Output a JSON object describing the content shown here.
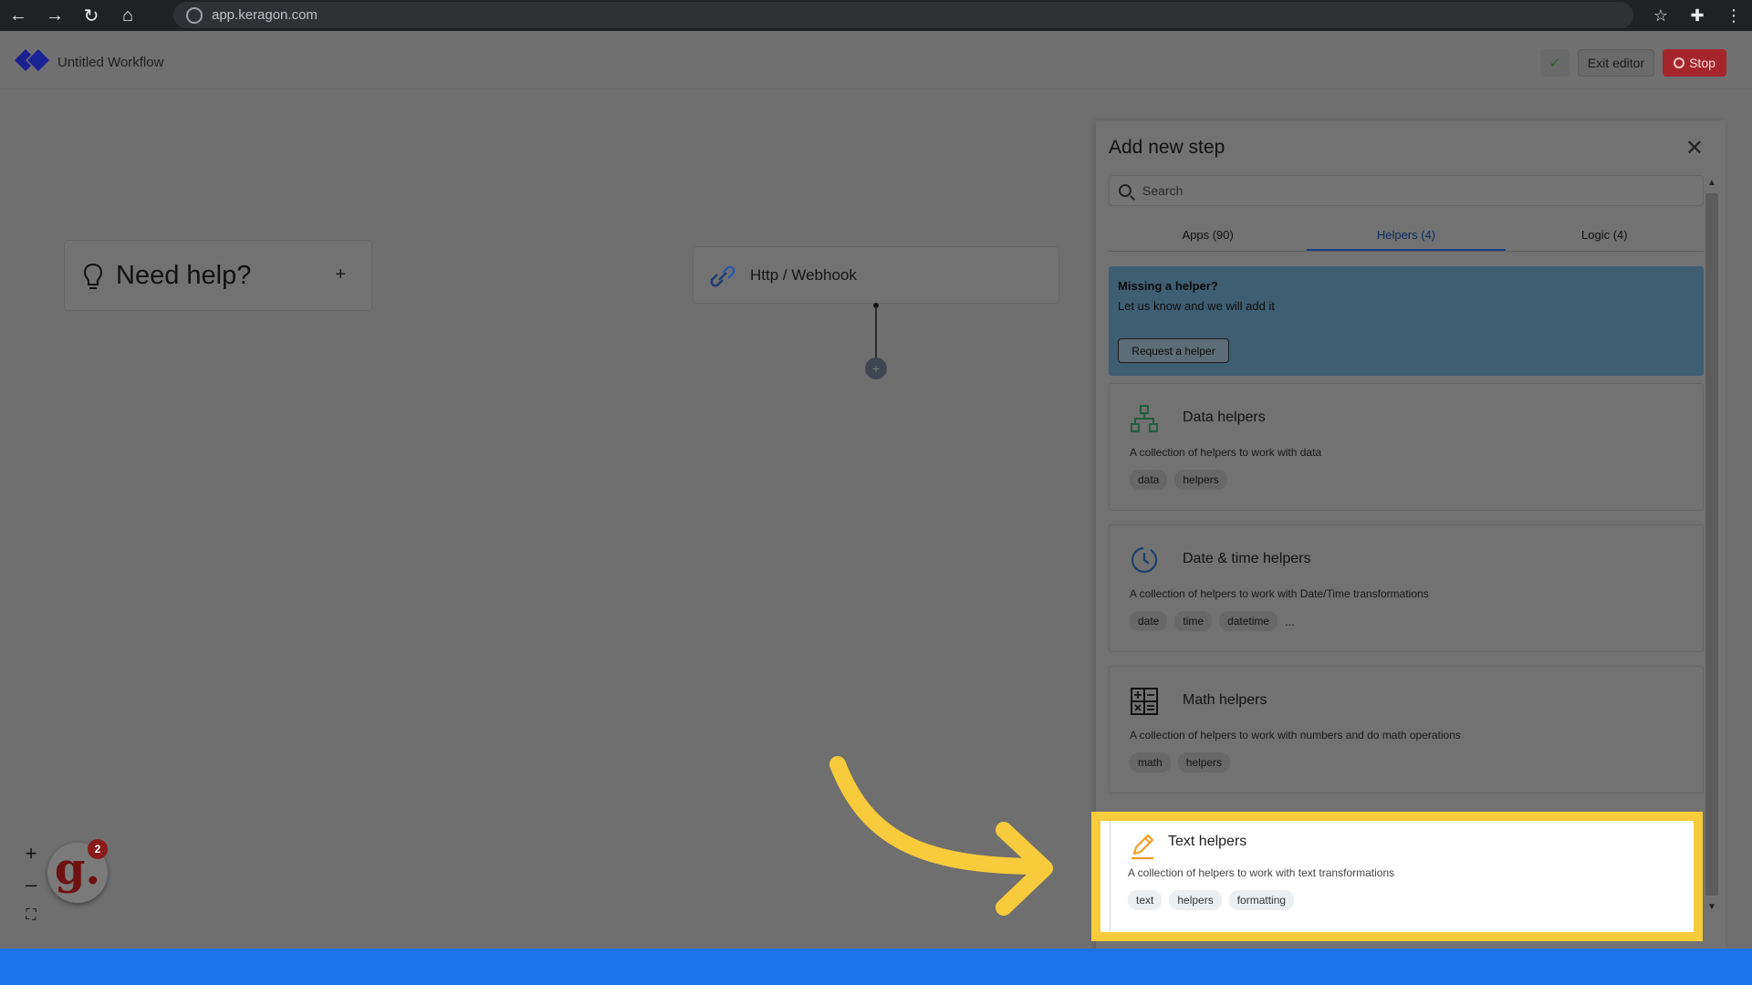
{
  "browser": {
    "url": "app.keragon.com"
  },
  "header": {
    "workflow_title": "Untitled Workflow",
    "exit_label": "Exit editor",
    "stop_label": "Stop",
    "check_glyph": "✓"
  },
  "canvas": {
    "help_label": "Need help?",
    "help_plus": "+",
    "trigger_label": "Http / Webhook",
    "add_step_glyph": "+"
  },
  "zoom": {
    "in": "+",
    "out": "–",
    "fit": "⛶"
  },
  "notification": {
    "letter": "g.",
    "count": "2"
  },
  "panel": {
    "title": "Add new step",
    "close": "✕",
    "search_placeholder": "Search",
    "tabs": [
      {
        "label": "Apps (90)",
        "active": false
      },
      {
        "label": "Helpers (4)",
        "active": true
      },
      {
        "label": "Logic (4)",
        "active": false
      }
    ],
    "missing": {
      "title": "Missing a helper?",
      "subtitle": "Let us know and we will add it",
      "button": "Request a helper"
    },
    "helpers": [
      {
        "name": "Data helpers",
        "icon": "data-hierarchy-icon",
        "description": "A collection of helpers to work with data",
        "tags": [
          "data",
          "helpers"
        ]
      },
      {
        "name": "Date & time helpers",
        "icon": "clock-icon",
        "description": "A collection of helpers to work with Date/Time transformations",
        "tags": [
          "date",
          "time",
          "datetime"
        ],
        "more": "..."
      },
      {
        "name": "Math helpers",
        "icon": "calculator-icon",
        "description": "A collection of helpers to work with numbers and do math operations",
        "tags": [
          "math",
          "helpers"
        ]
      },
      {
        "name": "Text helpers",
        "icon": "pencil-icon",
        "description": "A collection of helpers to work with text transformations",
        "tags": [
          "text",
          "helpers",
          "formatting"
        ]
      }
    ]
  },
  "colors": {
    "highlight": "#f7cb3b",
    "arrow": "#f7cb3b",
    "accent": "#1a73e8",
    "stop": "#a4262c"
  }
}
